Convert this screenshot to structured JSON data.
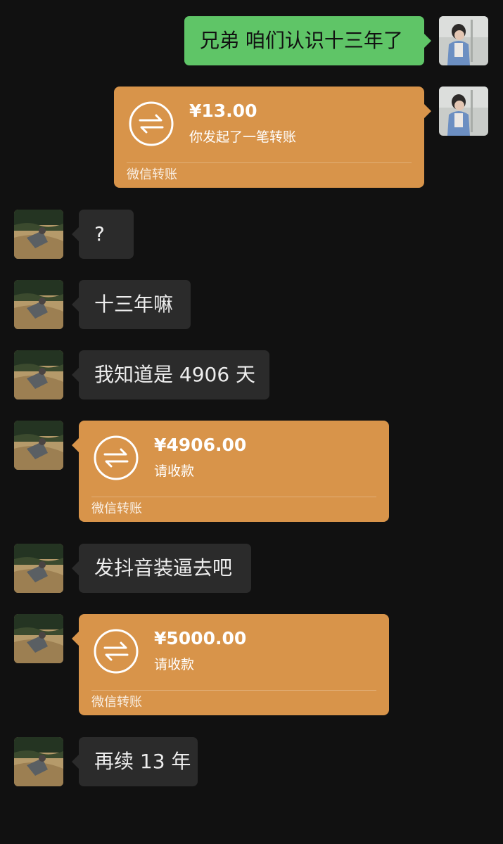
{
  "messages": [
    {
      "side": "right",
      "type": "text",
      "text": "兄弟 咱们认识十三年了"
    },
    {
      "side": "right",
      "type": "transfer",
      "amount": "¥13.00",
      "subtitle": "你发起了一笔转账",
      "footer": "微信转账"
    },
    {
      "side": "left",
      "type": "text",
      "text": "?"
    },
    {
      "side": "left",
      "type": "text",
      "text": "十三年嘛"
    },
    {
      "side": "left",
      "type": "text",
      "text": "我知道是 4906 天"
    },
    {
      "side": "left",
      "type": "transfer",
      "amount": "¥4906.00",
      "subtitle": "请收款",
      "footer": "微信转账"
    },
    {
      "side": "left",
      "type": "text",
      "text": "发抖音装逼去吧"
    },
    {
      "side": "left",
      "type": "transfer",
      "amount": "¥5000.00",
      "subtitle": "请收款",
      "footer": "微信转账"
    },
    {
      "side": "left",
      "type": "text",
      "text": "再续 13 年"
    }
  ],
  "colors": {
    "background": "#111111",
    "self_bubble": "#5fc567",
    "other_bubble": "#2b2b2b",
    "transfer": "#d8944a"
  },
  "icons": {
    "transfer": "transfer-arrows-icon",
    "self_avatar": "child-photo-avatar",
    "other_avatar": "field-photo-avatar"
  }
}
